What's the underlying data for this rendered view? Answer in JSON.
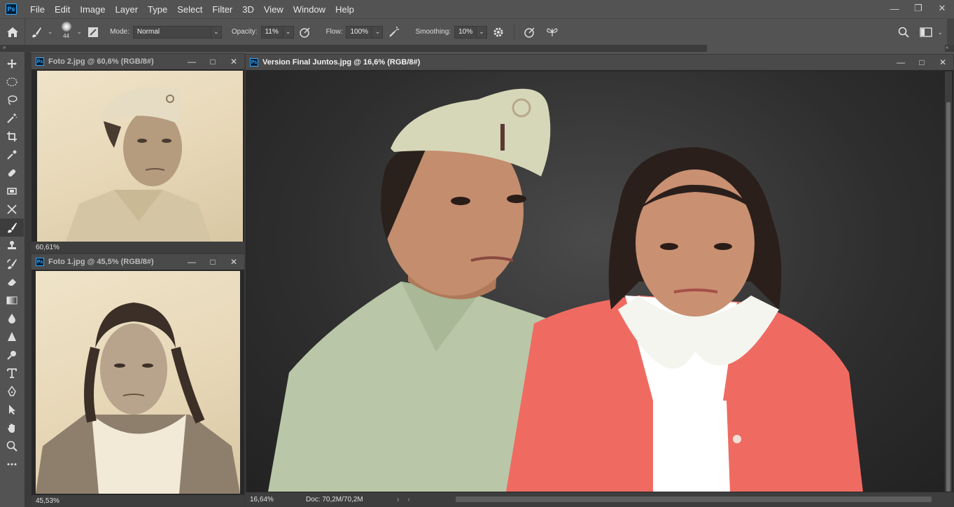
{
  "app": {
    "logo": "Ps"
  },
  "menu": [
    "File",
    "Edit",
    "Image",
    "Layer",
    "Type",
    "Select",
    "Filter",
    "3D",
    "View",
    "Window",
    "Help"
  ],
  "options": {
    "brush_size": "44",
    "mode_label": "Mode:",
    "mode_value": "Normal",
    "opacity_label": "Opacity:",
    "opacity_value": "11%",
    "flow_label": "Flow:",
    "flow_value": "100%",
    "smoothing_label": "Smoothing:",
    "smoothing_value": "10%"
  },
  "documents": {
    "doc1": {
      "title": "Foto 2.jpg @ 60,6% (RGB/8#)",
      "zoom": "60,61%"
    },
    "doc2": {
      "title": "Foto 1.jpg @ 45,5% (RGB/8#)",
      "zoom": "45,53%"
    },
    "doc3": {
      "title": "Version Final Juntos.jpg @ 16,6% (RGB/8#)",
      "zoom": "16,64%",
      "doc_size": "Doc: 70,2M/70,2M"
    }
  },
  "tools": [
    "move-tool",
    "marquee-tool",
    "lasso-tool",
    "magic-wand-tool",
    "crop-tool",
    "eyedropper-tool",
    "healing-brush-tool",
    "patch-tool",
    "content-aware-move-tool",
    "brush-tool",
    "clone-stamp-tool",
    "history-brush-tool",
    "eraser-tool",
    "gradient-tool",
    "blur-tool",
    "sharpen-tool",
    "dodge-tool",
    "type-tool",
    "pen-tool",
    "path-selection-tool",
    "hand-tool",
    "zoom-tool",
    "more-tools"
  ],
  "colors": {
    "accent": "#31a8ff",
    "chrome": "#535353",
    "canvas_bg": "#282828"
  }
}
